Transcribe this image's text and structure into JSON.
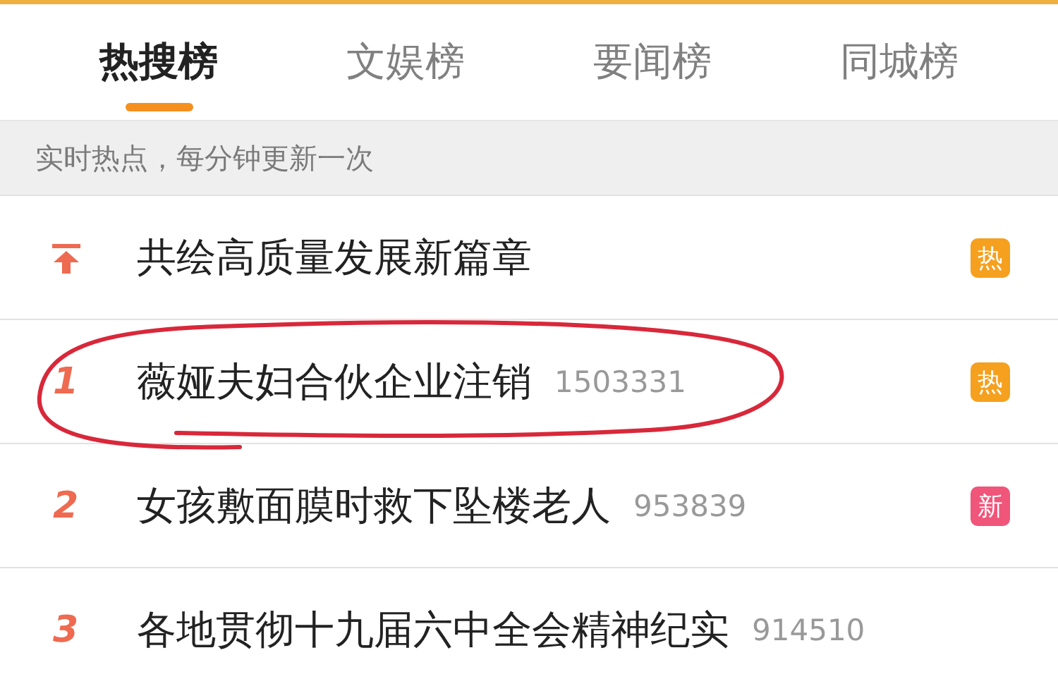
{
  "tabs": [
    {
      "label": "热搜榜",
      "selected": true
    },
    {
      "label": "文娱榜",
      "selected": false
    },
    {
      "label": "要闻榜",
      "selected": false
    },
    {
      "label": "同城榜",
      "selected": false
    }
  ],
  "notice": "实时热点，每分钟更新一次",
  "items": [
    {
      "kind": "pinned",
      "title": "共绘高质量发展新篇章",
      "badge": "热",
      "color": "#f5a01e",
      "circled": false
    },
    {
      "kind": "rank",
      "rank": "1",
      "title": "薇娅夫妇合伙企业注销",
      "count": "1503331",
      "badge": "热",
      "color": "#f5a01e",
      "circled": true
    },
    {
      "kind": "rank",
      "rank": "2",
      "title": "女孩敷面膜时救下坠楼老人",
      "count": "953839",
      "badge": "新",
      "color": "#f0557a",
      "circled": false
    },
    {
      "kind": "rank",
      "rank": "3",
      "title": "各地贯彻十九届六中全会精神纪实",
      "count": "914510",
      "circled": false
    }
  ]
}
